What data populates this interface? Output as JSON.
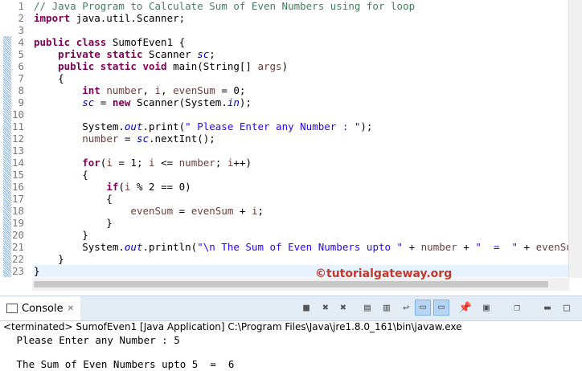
{
  "code_lines": [
    [
      [
        "// Java Program to Calculate Sum of Even Numbers using for loop",
        "cm"
      ]
    ],
    [
      [
        "import",
        "kw"
      ],
      [
        " java.util.Scanner;",
        ""
      ]
    ],
    [],
    [
      [
        "public",
        "kw"
      ],
      [
        " ",
        ""
      ],
      [
        "class",
        "kw"
      ],
      [
        " SumofEven1 {",
        ""
      ]
    ],
    [
      [
        "    ",
        ""
      ],
      [
        "private",
        "kw"
      ],
      [
        " ",
        ""
      ],
      [
        "static",
        "kw"
      ],
      [
        " Scanner ",
        ""
      ],
      [
        "sc",
        "fld"
      ],
      [
        ";",
        ""
      ]
    ],
    [
      [
        "    ",
        ""
      ],
      [
        "public",
        "kw"
      ],
      [
        " ",
        ""
      ],
      [
        "static",
        "kw"
      ],
      [
        " ",
        ""
      ],
      [
        "void",
        "kw"
      ],
      [
        " main(String[] ",
        ""
      ],
      [
        "args",
        "var"
      ],
      [
        ")",
        ""
      ]
    ],
    [
      [
        "    {",
        ""
      ]
    ],
    [
      [
        "        ",
        ""
      ],
      [
        "int",
        "kw"
      ],
      [
        " ",
        ""
      ],
      [
        "number",
        "var"
      ],
      [
        ", ",
        ""
      ],
      [
        "i",
        "var"
      ],
      [
        ", ",
        ""
      ],
      [
        "evenSum",
        "var"
      ],
      [
        " = 0;",
        ""
      ]
    ],
    [
      [
        "        ",
        ""
      ],
      [
        "sc",
        "fld"
      ],
      [
        " = ",
        ""
      ],
      [
        "new",
        "kw"
      ],
      [
        " Scanner(System.",
        ""
      ],
      [
        "in",
        "fld"
      ],
      [
        ");",
        ""
      ]
    ],
    [],
    [
      [
        "        System.",
        ""
      ],
      [
        "out",
        "fld"
      ],
      [
        ".print(",
        ""
      ],
      [
        "\" Please Enter any Number : \"",
        "st"
      ],
      [
        ");",
        ""
      ]
    ],
    [
      [
        "        ",
        ""
      ],
      [
        "number",
        "var"
      ],
      [
        " = ",
        ""
      ],
      [
        "sc",
        "fld"
      ],
      [
        ".nextInt();",
        ""
      ]
    ],
    [],
    [
      [
        "        ",
        ""
      ],
      [
        "for",
        "kw"
      ],
      [
        "(",
        ""
      ],
      [
        "i",
        "var"
      ],
      [
        " = 1; ",
        ""
      ],
      [
        "i",
        "var"
      ],
      [
        " <= ",
        ""
      ],
      [
        "number",
        "var"
      ],
      [
        "; ",
        ""
      ],
      [
        "i",
        "var"
      ],
      [
        "++)",
        ""
      ]
    ],
    [
      [
        "        {",
        ""
      ]
    ],
    [
      [
        "            ",
        ""
      ],
      [
        "if",
        "kw"
      ],
      [
        "(",
        ""
      ],
      [
        "i",
        "var"
      ],
      [
        " % 2 == 0)",
        ""
      ]
    ],
    [
      [
        "            {",
        ""
      ]
    ],
    [
      [
        "                ",
        ""
      ],
      [
        "evenSum",
        "var"
      ],
      [
        " = ",
        ""
      ],
      [
        "evenSum",
        "var"
      ],
      [
        " + ",
        ""
      ],
      [
        "i",
        "var"
      ],
      [
        ";",
        ""
      ]
    ],
    [
      [
        "            }",
        ""
      ]
    ],
    [
      [
        "        }",
        ""
      ]
    ],
    [
      [
        "        System.",
        ""
      ],
      [
        "out",
        "fld"
      ],
      [
        ".println(",
        ""
      ],
      [
        "\"\\n The Sum of Even Numbers upto \"",
        "st"
      ],
      [
        " + ",
        ""
      ],
      [
        "number",
        "var"
      ],
      [
        " + ",
        ""
      ],
      [
        "\"  =  \"",
        "st"
      ],
      [
        " + ",
        ""
      ],
      [
        "evenSum",
        "var"
      ],
      [
        ");",
        ""
      ]
    ],
    [
      [
        "    }",
        ""
      ]
    ],
    [
      [
        "}",
        ""
      ]
    ]
  ],
  "watermark": "©tutorialgateway.org",
  "console": {
    "tab_label": "Console",
    "close_glyph": "✕",
    "terminated": "<terminated> SumofEven1 [Java Application] C:\\Program Files\\Java\\jre1.8.0_161\\bin\\javaw.exe",
    "output": [
      " Please Enter any Number : 5",
      "",
      " The Sum of Even Numbers upto 5  =  6"
    ]
  },
  "toolbar_icons": [
    "stop-icon",
    "remove-launch-icon",
    "remove-all-icon",
    "clear-console-icon",
    "scroll-lock-icon",
    "word-wrap-icon",
    "show-on-stdout-icon",
    "show-on-stderr-icon",
    "pin-console-icon",
    "display-console-icon",
    "open-console-icon",
    "minimize-icon",
    "maximize-icon"
  ]
}
